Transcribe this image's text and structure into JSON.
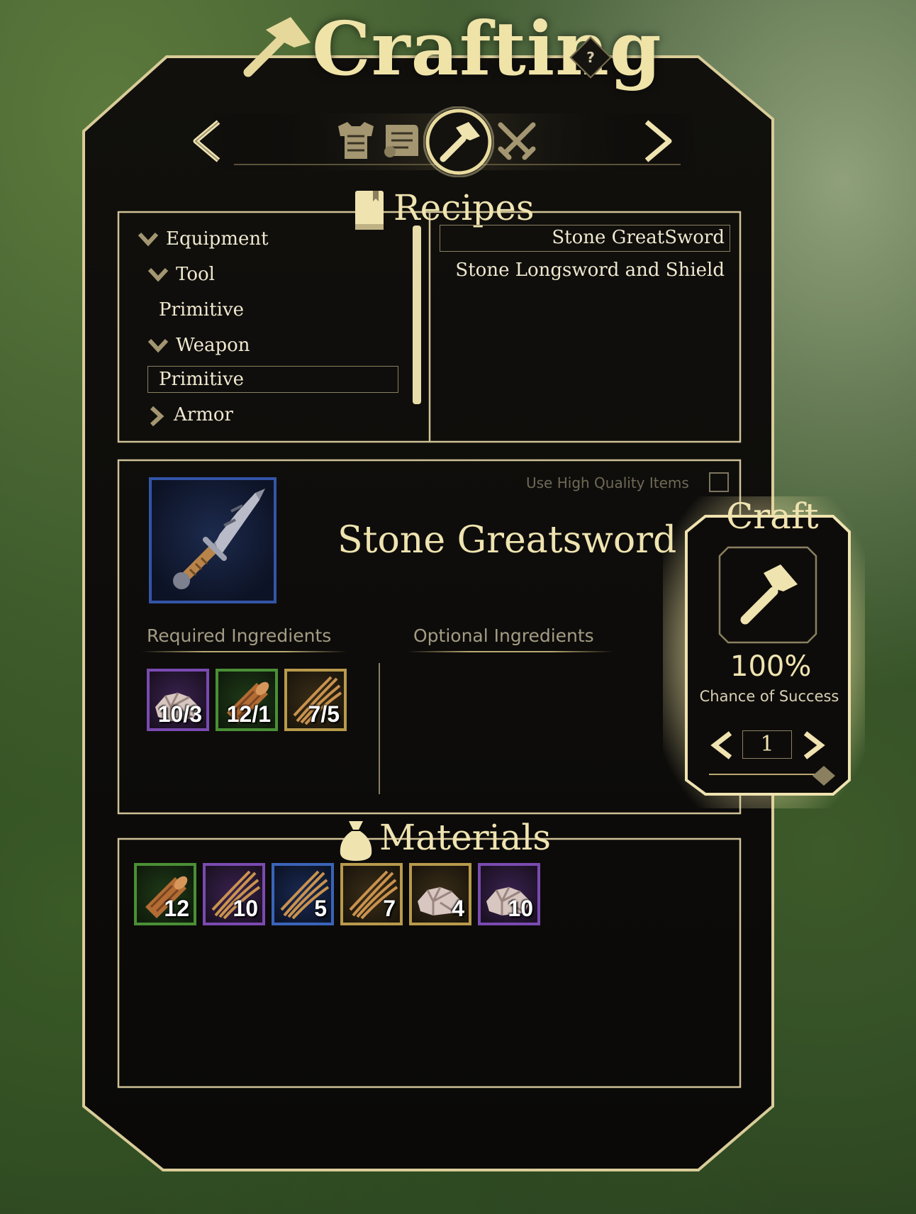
{
  "window": {
    "title": "Crafting",
    "help_label": "?"
  },
  "categories": {
    "items": [
      {
        "name": "armor-category-icon"
      },
      {
        "name": "scroll-category-icon"
      },
      {
        "name": "crafting-hammer-category-icon",
        "active": true
      },
      {
        "name": "weapons-category-icon"
      }
    ]
  },
  "recipes": {
    "heading": "Recipes",
    "tree": [
      {
        "label": "Equipment",
        "expanded": true
      },
      {
        "label": "Tool",
        "expanded": true
      },
      {
        "label": "Primitive"
      },
      {
        "label": "Weapon",
        "expanded": true
      },
      {
        "label": "Primitive",
        "selected": true
      },
      {
        "label": "Armor",
        "expanded": false
      }
    ],
    "list": [
      {
        "label": "Stone GreatSword",
        "selected": true
      },
      {
        "label": "Stone Longsword and Shield"
      }
    ]
  },
  "details": {
    "use_high_quality_label": "Use High Quality Items",
    "use_high_quality_checked": false,
    "item_name": "Stone Greatsword",
    "required_label": "Required Ingredients",
    "optional_label": "Optional Ingredients",
    "required": [
      {
        "icon": "stone-icon",
        "rarity": "purple",
        "qty": "10/3"
      },
      {
        "icon": "wood-log-icon",
        "rarity": "green",
        "qty": "12/1"
      },
      {
        "icon": "fiber-icon",
        "rarity": "gold",
        "qty": "7/5"
      }
    ]
  },
  "materials": {
    "heading": "Materials",
    "items": [
      {
        "icon": "wood-log-icon",
        "rarity": "green",
        "qty": "12"
      },
      {
        "icon": "fiber-icon",
        "rarity": "purple",
        "qty": "10"
      },
      {
        "icon": "fiber-icon",
        "rarity": "blue",
        "qty": "5"
      },
      {
        "icon": "fiber-icon",
        "rarity": "gold",
        "qty": "7"
      },
      {
        "icon": "stone-icon",
        "rarity": "gold",
        "qty": "4"
      },
      {
        "icon": "stone-icon",
        "rarity": "purple",
        "qty": "10"
      }
    ]
  },
  "craft": {
    "title": "Craft",
    "chance": "100%",
    "chance_label": "Chance of Success",
    "quantity": "1"
  },
  "colors": {
    "accent_gold": "#efe3b0",
    "frame_gold": "#d9cc98",
    "panel_bg": "#0f0d0b",
    "rarity_purple": "#7a4ab0",
    "rarity_green": "#4a8f36",
    "rarity_gold": "#b89a4c",
    "rarity_blue": "#3a64b8"
  }
}
